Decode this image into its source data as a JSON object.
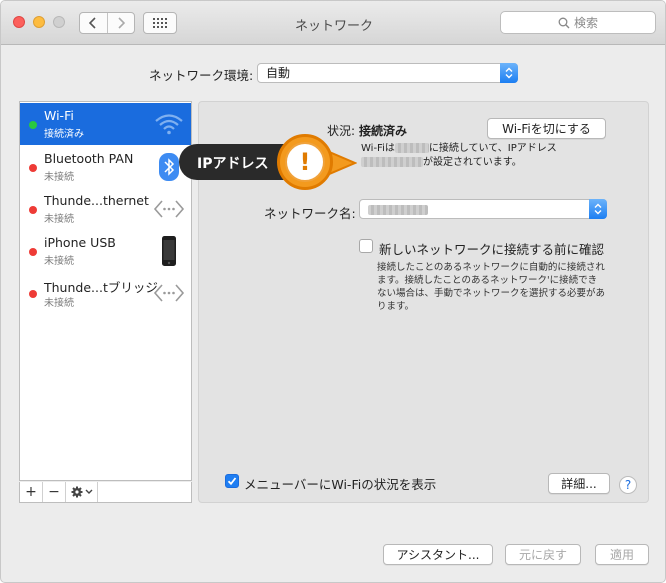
{
  "window": {
    "title": "ネットワーク"
  },
  "search": {
    "placeholder": "検索"
  },
  "location": {
    "label": "ネットワーク環境:",
    "value": "自動"
  },
  "services": [
    {
      "name": "Wi-Fi",
      "status": "接続済み",
      "dot_color": "#29c940",
      "icon": "wifi-icon"
    },
    {
      "name": "Bluetooth PAN",
      "status": "未接続",
      "dot_color": "#ee3b36",
      "icon": "bluetooth-icon"
    },
    {
      "name": "Thunde...thernet",
      "status": "未接続",
      "dot_color": "#ee3b36",
      "icon": "ethernet-icon"
    },
    {
      "name": "iPhone USB",
      "status": "未接続",
      "dot_color": "#ee3b36",
      "icon": "iphone-icon"
    },
    {
      "name": "Thunde...tブリッジ",
      "status": "未接続",
      "dot_color": "#ee3b36",
      "icon": "bridge-icon"
    }
  ],
  "sidebar_tools": {
    "add": "+",
    "remove": "−"
  },
  "detail": {
    "status_label": "状況:",
    "status_value": "接続済み",
    "wifi_off_button": "Wi-Fiを切にする",
    "description_part1": "Wi-Fiは",
    "description_part2": "に接続していて、IPアドレス",
    "description_part3": "が設定されています。",
    "network_name_label": "ネットワーク名:",
    "ask_checkbox_label": "新しいネットワークに接続する前に確認",
    "ask_checked": false,
    "ask_description": "接続したことのあるネットワークに自動的に接続されます。接続したことのあるネットワーク'に接続できない場合は、手動でネットワークを選択する必要があります。",
    "menubar_checkbox_label": "メニューバーにWi-Fiの状況を表示",
    "menubar_checked": true,
    "advanced_button": "詳細...",
    "help": "?"
  },
  "callout": {
    "label": "IPアドレス",
    "symbol": "!"
  },
  "footer": {
    "assistant": "アシスタント...",
    "revert": "元に戻す",
    "apply": "適用"
  },
  "colors": {
    "selection": "#1a6cde",
    "accent": "#1f7ef2",
    "callout": "#f39a1e"
  }
}
